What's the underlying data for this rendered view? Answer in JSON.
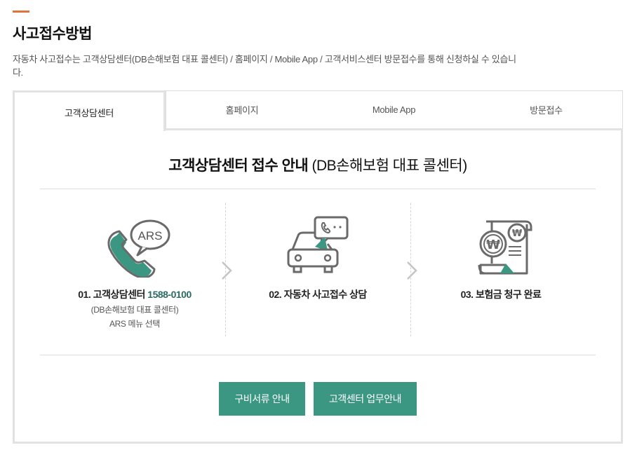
{
  "section": {
    "title": "사고접수방법",
    "description": "자동차 사고접수는 고객상담센터(DB손해보험 대표 콜센터) / 홈페이지 / Mobile App / 고객서비스센터 방문접수를 통해 신청하실 수 있습니다."
  },
  "tabs": [
    {
      "label": "고객상담센터",
      "active": true
    },
    {
      "label": "홈페이지",
      "active": false
    },
    {
      "label": "Mobile App",
      "active": false
    },
    {
      "label": "방문접수",
      "active": false
    }
  ],
  "content": {
    "title_bold": "고객상담센터 접수 안내",
    "title_normal": " (DB손해보험 대표 콜센터)",
    "steps": [
      {
        "label": "01. 고객상담센터 ",
        "phone": "1588-0100",
        "sub1": "(DB손해보험 대표 콜센터)",
        "sub2": "ARS 메뉴 선택",
        "icon_text": "ARS"
      },
      {
        "label": "02. 자동차 사고접수 상담"
      },
      {
        "label": "03. 보험금 청구 완료",
        "icon_text": "₩"
      }
    ],
    "buttons": [
      {
        "label": "구비서류 안내"
      },
      {
        "label": "고객센터 업무안내"
      }
    ]
  },
  "colors": {
    "accent": "#e0733a",
    "green": "#3b9682",
    "phone_text": "#2a6b63",
    "icon_stroke": "#6a6a6a"
  }
}
